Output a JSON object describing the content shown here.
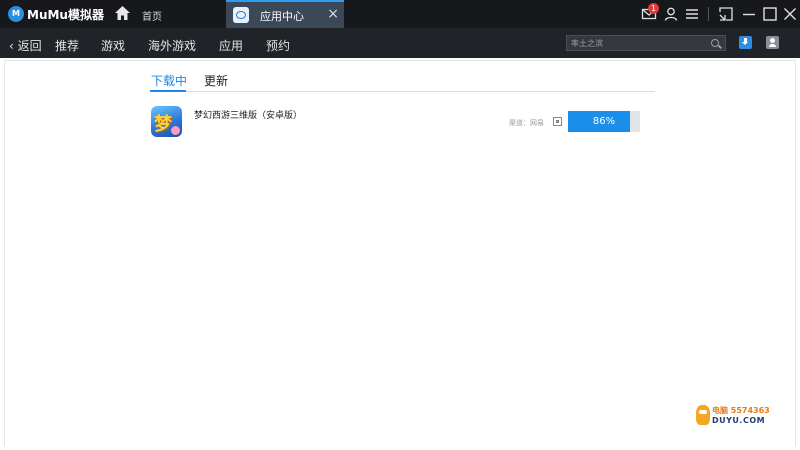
{
  "titlebar": {
    "app_name": "MuMu模拟器",
    "logo_text": "M",
    "home_label": "首页",
    "tab_label": "应用中心",
    "tab_close": "×",
    "notification_count": "1"
  },
  "nav": {
    "back_label": "‹ 返回",
    "items": [
      "推荐",
      "游戏",
      "海外游戏",
      "应用",
      "预约"
    ],
    "search_placeholder": "率土之滨"
  },
  "downloads": {
    "tabs": [
      "下载中",
      "更新"
    ],
    "app": {
      "name": "梦幻西游三维版（安卓版）",
      "channel": "渠道：网易",
      "progress_label": "86%",
      "progress": 0.86
    }
  },
  "watermark": {
    "line1": "电脑 5574363",
    "line2": "DUYU.COM"
  },
  "colors": {
    "accent": "#1a8ee8",
    "titlebar_bg": "#16181c",
    "navbar_bg": "#202328",
    "tab_bg": "#3b4858",
    "badge": "#e23b3b"
  }
}
